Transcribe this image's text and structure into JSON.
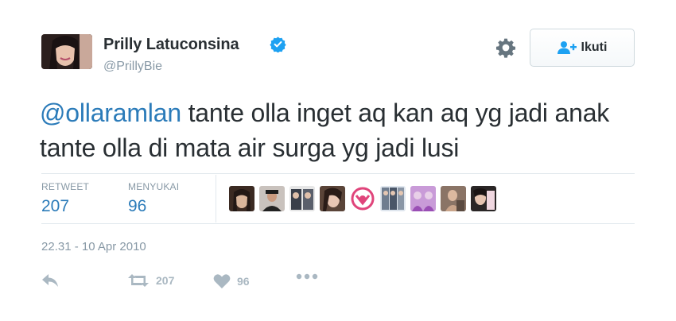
{
  "user": {
    "display_name": "Prilly Latuconsina",
    "username": "@PrillyBie",
    "verified": true
  },
  "header": {
    "follow_label": "Ikuti",
    "follow_icon": "add-user-icon",
    "settings_icon": "gear-icon"
  },
  "tweet": {
    "mention": "@ollaramlan",
    "text": " tante olla inget aq kan aq yg jadi anak tante olla di mata air surga yg jadi lusi"
  },
  "stats": {
    "retweets_label": "RETWEET",
    "retweets_count": "207",
    "likes_label": "MENYUKAI",
    "likes_count": "96"
  },
  "likers_count_shown": 9,
  "timestamp": "22.31 - 10 Apr 2010",
  "actions": {
    "retweet_count": "207",
    "like_count": "96"
  },
  "colors": {
    "link": "#2b7bb9",
    "muted": "#8899a6",
    "verified": "#1da1f2",
    "icon": "#aab8c2"
  }
}
